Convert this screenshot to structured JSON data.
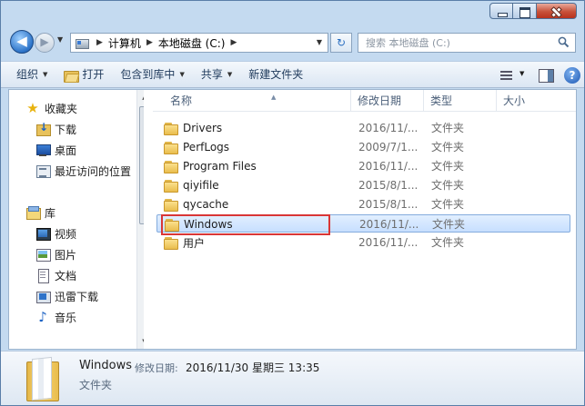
{
  "address": {
    "crumbs": [
      "计算机",
      "本地磁盘 (C:)"
    ]
  },
  "search": {
    "placeholder": "搜索 本地磁盘 (C:)"
  },
  "toolbar": {
    "organize": "组织",
    "open": "打开",
    "include_in_library": "包含到库中",
    "share": "共享",
    "new_folder": "新建文件夹"
  },
  "nav_pane": {
    "favorites": {
      "label": "收藏夹",
      "items": [
        "下载",
        "桌面",
        "最近访问的位置"
      ]
    },
    "libraries": {
      "label": "库",
      "items": [
        "视频",
        "图片",
        "文档",
        "迅雷下载",
        "音乐"
      ]
    }
  },
  "columns": {
    "name": "名称",
    "modified": "修改日期",
    "type": "类型",
    "size": "大小"
  },
  "files": [
    {
      "name": "Drivers",
      "date": "2016/11/...",
      "type": "文件夹",
      "selected": false
    },
    {
      "name": "PerfLogs",
      "date": "2009/7/1...",
      "type": "文件夹",
      "selected": false
    },
    {
      "name": "Program Files",
      "date": "2016/11/...",
      "type": "文件夹",
      "selected": false
    },
    {
      "name": "qiyifile",
      "date": "2015/8/1...",
      "type": "文件夹",
      "selected": false
    },
    {
      "name": "qycache",
      "date": "2015/8/1...",
      "type": "文件夹",
      "selected": false
    },
    {
      "name": "Windows",
      "date": "2016/11/...",
      "type": "文件夹",
      "selected": true
    },
    {
      "name": "用户",
      "date": "2016/11/...",
      "type": "文件夹",
      "selected": false
    }
  ],
  "details": {
    "name": "Windows",
    "modified_label": "修改日期:",
    "modified_value": "2016/11/30 星期三 13:35",
    "type": "文件夹"
  },
  "colors": {
    "selection": "#cce4ff",
    "highlight_box": "#d93636",
    "chrome": "#c4daf0"
  }
}
